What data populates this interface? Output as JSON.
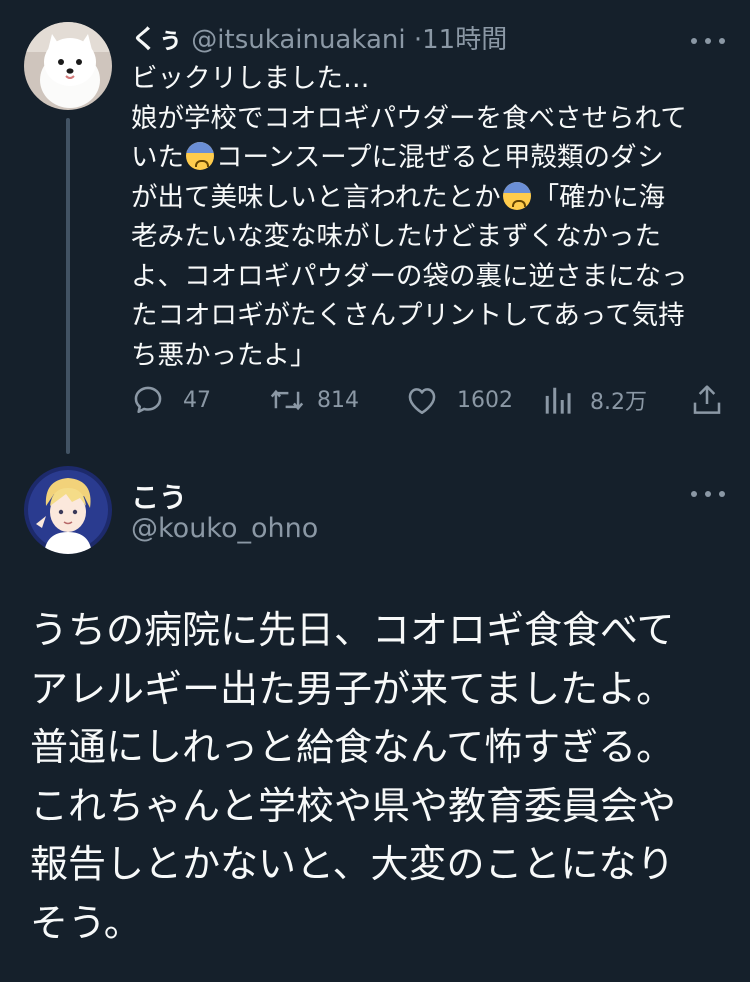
{
  "parent_tweet": {
    "display_name": "くぅ",
    "handle": "@itsukainuakani",
    "separator": "·",
    "timestamp": "11時間",
    "lines": [
      "ビックリしました…",
      "娘が学校でコオロギパウダーを食べさせられて",
      "いた",
      "コーンスープに混ぜると甲殻類のダシ",
      "が出て美味しいと言われたとか",
      "「確かに海",
      "老みたいな変な味がしたけどまずくなかった",
      "よ、コオロギパウダーの袋の裏に逆さまになっ",
      "たコオロギがたくさんプリントしてあって気持",
      "ち悪かったよ」"
    ],
    "emoji_name": "anxious-face-with-sweat-emoji",
    "actions": {
      "reply_count": "47",
      "retweet_count": "814",
      "like_count": "1602",
      "view_count": "8.2万"
    }
  },
  "reply_tweet": {
    "display_name": "こう",
    "handle": "@kouko_ohno",
    "lines": [
      "うちの病院に先日、コオロギ食食べて",
      "アレルギー出た男子が来てましたよ。",
      "普通にしれっと給食なんて怖すぎる。",
      "これちゃんと学校や県や教育委員会や",
      "報告しとかないと、大変のことになり",
      "そう。"
    ]
  },
  "colors": {
    "background": "#15202b",
    "primary_text": "#f7f9f9",
    "secondary_text": "#8b98a5",
    "thread_line": "#425364"
  }
}
